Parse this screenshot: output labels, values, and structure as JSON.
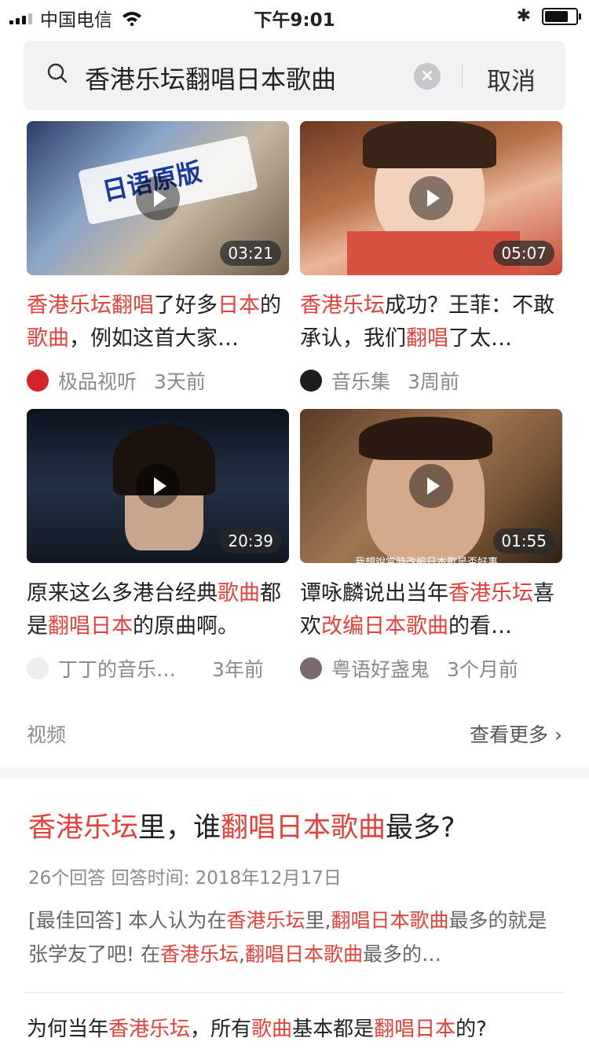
{
  "status_bar": {
    "carrier": "中国电信",
    "time": "下午9:01",
    "battery_level": 0.75
  },
  "search": {
    "query": "香港乐坛翻唱日本歌曲",
    "cancel_label": "取消"
  },
  "videos": [
    {
      "duration": "03:21",
      "overlay_text": "日语原版",
      "title_parts": [
        {
          "text": "香港乐坛翻唱",
          "hl": true
        },
        {
          "text": "了好多",
          "hl": false
        },
        {
          "text": "日本",
          "hl": true
        },
        {
          "text": "的",
          "hl": false
        },
        {
          "text": "歌曲",
          "hl": true
        },
        {
          "text": "，例如这首大家…",
          "hl": false
        }
      ],
      "source": "极品视听",
      "time_ago": "3天前",
      "avatar_color": "#d4242a"
    },
    {
      "duration": "05:07",
      "overlay_text": "",
      "title_parts": [
        {
          "text": "香港乐坛",
          "hl": true
        },
        {
          "text": "成功？王菲：不敢承认，我们",
          "hl": false
        },
        {
          "text": "翻唱",
          "hl": true
        },
        {
          "text": "了太…",
          "hl": false
        }
      ],
      "source": "音乐集",
      "time_ago": "3周前",
      "avatar_color": "#1d1d1d"
    },
    {
      "duration": "20:39",
      "overlay_text": "",
      "title_parts": [
        {
          "text": "原来这么多港台经典",
          "hl": false
        },
        {
          "text": "歌曲",
          "hl": true
        },
        {
          "text": "都是",
          "hl": false
        },
        {
          "text": "翻唱日本",
          "hl": true
        },
        {
          "text": "的原曲啊。",
          "hl": false
        }
      ],
      "source": "丁丁的音乐…",
      "time_ago": "3年前",
      "avatar_color": "#eeeeee"
    },
    {
      "duration": "01:55",
      "overlay_text": "我想說當時改編日本歌是否好事",
      "title_parts": [
        {
          "text": "谭咏麟说出当年",
          "hl": false
        },
        {
          "text": "香港乐坛",
          "hl": true
        },
        {
          "text": "喜欢",
          "hl": false
        },
        {
          "text": "改编日本歌曲",
          "hl": true
        },
        {
          "text": "的看…",
          "hl": false
        }
      ],
      "source": "粤语好盏鬼",
      "time_ago": "3个月前",
      "avatar_color": "#7a6a70"
    }
  ],
  "video_section": {
    "label": "视频",
    "more_label": "查看更多"
  },
  "qa": {
    "title_parts": [
      {
        "text": "香港乐坛",
        "hl": true
      },
      {
        "text": "里，谁",
        "hl": false
      },
      {
        "text": "翻唱日本歌曲",
        "hl": true
      },
      {
        "text": "最多?",
        "hl": false
      }
    ],
    "meta": "26个回答 回答时间: 2018年12月17日",
    "snippet_parts": [
      {
        "text": "[最佳回答] 本人认为在",
        "hl": false
      },
      {
        "text": "香港乐坛",
        "hl": true
      },
      {
        "text": "里,",
        "hl": false
      },
      {
        "text": "翻唱日本歌曲",
        "hl": true
      },
      {
        "text": "最多的就是张学友了吧! 在",
        "hl": false
      },
      {
        "text": "香港乐坛",
        "hl": true
      },
      {
        "text": ",",
        "hl": false
      },
      {
        "text": "翻唱日本歌曲",
        "hl": true
      },
      {
        "text": "最多的…",
        "hl": false
      }
    ]
  },
  "qa2": {
    "title_parts": [
      {
        "text": "为何当年",
        "hl": false
      },
      {
        "text": "香港乐坛",
        "hl": true
      },
      {
        "text": "，所有",
        "hl": false
      },
      {
        "text": "歌曲",
        "hl": true
      },
      {
        "text": "基本都是",
        "hl": false
      },
      {
        "text": "翻唱日本",
        "hl": true
      },
      {
        "text": "的?",
        "hl": false
      }
    ]
  },
  "colors": {
    "highlight": "#e5413b",
    "meta": "#8a8a8a"
  }
}
